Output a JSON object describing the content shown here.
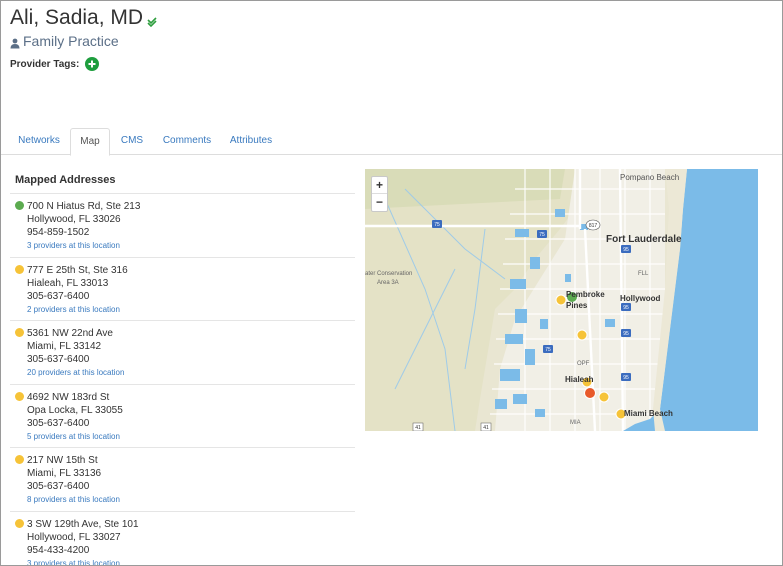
{
  "provider": {
    "name": "Ali, Sadia, MD",
    "specialty": "Family Practice",
    "tags_label": "Provider Tags:"
  },
  "tabs": [
    {
      "label": "Networks"
    },
    {
      "label": "Map"
    },
    {
      "label": "CMS"
    },
    {
      "label": "Comments"
    },
    {
      "label": "Attributes"
    }
  ],
  "active_tab": "Map",
  "addresses": {
    "title": "Mapped Addresses",
    "items": [
      {
        "line1": "700 N Hiatus Rd, Ste 213",
        "line2": "Hollywood, FL 33026",
        "phone": "954-859-1502",
        "link": "3 providers at this location",
        "color": "#5cab50"
      },
      {
        "line1": "777 E 25th St, Ste 316",
        "line2": "Hialeah, FL 33013",
        "phone": "305-637-6400",
        "link": "2 providers at this location",
        "color": "#f6c338"
      },
      {
        "line1": "5361 NW 22nd Ave",
        "line2": "Miami, FL 33142",
        "phone": "305-637-6400",
        "link": "20 providers at this location",
        "color": "#f6c338"
      },
      {
        "line1": "4692 NW 183rd St",
        "line2": "Opa Locka, FL 33055",
        "phone": "305-637-6400",
        "link": "5 providers at this location",
        "color": "#f6c338"
      },
      {
        "line1": "217 NW 15th St",
        "line2": "Miami, FL 33136",
        "phone": "305-637-6400",
        "link": "8 providers at this location",
        "color": "#f6c338"
      },
      {
        "line1": "3 SW 129th Ave, Ste 101",
        "line2": "Hollywood, FL 33027",
        "phone": "954-433-4200",
        "link": "3 providers at this location",
        "color": "#f6c338"
      }
    ]
  },
  "map": {
    "zoom_in": "+",
    "zoom_out": "−",
    "labels": {
      "pompano": "Pompano Beach",
      "fortlaud": "Fort Lauderdale",
      "hollywood": "Hollywood",
      "pembroke1": "Pembroke",
      "pembroke2": "Pines",
      "hialeah": "Hialeah",
      "miamibeach": "Miami Beach",
      "wca1": "ater Conservation",
      "wca2": "Area 3A",
      "fll": "FLL",
      "opf": "OPF",
      "mia": "MIA",
      "r817": "817",
      "r75a": "75",
      "r75b": "75",
      "r95a": "95",
      "r95b": "95",
      "r95c": "95",
      "r95d": "95",
      "r75c": "75",
      "r41a": "41",
      "r41b": "41"
    },
    "colors": {
      "water": "#7bbbe8",
      "land": "#e9e5cf",
      "marker_green": "#5cab50",
      "marker_yellow": "#f6c338",
      "marker_red": "#e85a2a"
    }
  }
}
